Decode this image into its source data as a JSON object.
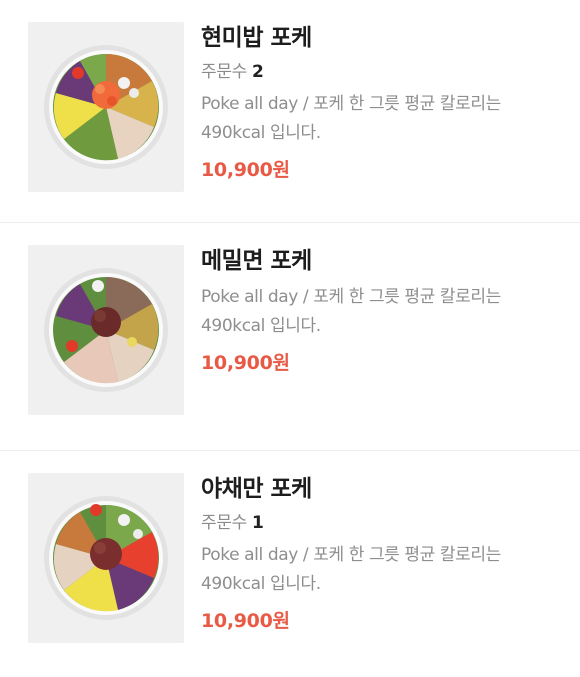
{
  "items": [
    {
      "name": "현미밥 포케",
      "order_label": "주문수",
      "order_count": "2",
      "desc_line1": "Poke all day / 포케 한 그릇 평균 칼로리는",
      "desc_line2": "490kcal 입니다.",
      "price": "10,900원"
    },
    {
      "name": "메밀면 포케",
      "desc_line1": "Poke all day / 포케 한 그릇 평균 칼로리는",
      "desc_line2": "490kcal 입니다.",
      "price": "10,900원"
    },
    {
      "name": "야채만 포케",
      "order_label": "주문수",
      "order_count": "1",
      "desc_line1": "Poke all day / 포케 한 그릇 평균 칼로리는",
      "desc_line2": "490kcal 입니다.",
      "price": "10,900원"
    }
  ],
  "colors": {
    "price": "#e85a45",
    "thumb_bg": "#f0f0f0",
    "divider": "#ececec"
  }
}
